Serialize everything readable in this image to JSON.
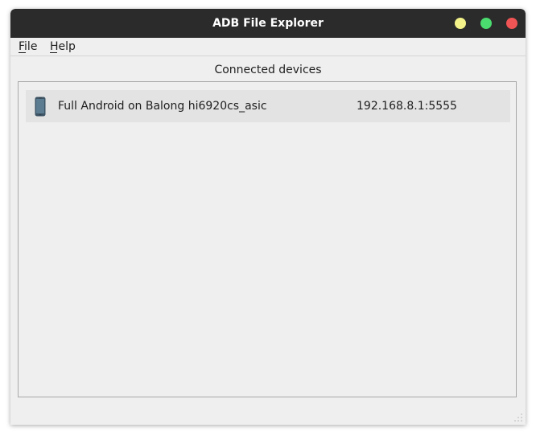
{
  "window": {
    "title": "ADB File Explorer",
    "controls": {
      "minimize_color": "#f3f38a",
      "maximize_color": "#4bdc6f",
      "close_color": "#f05454"
    }
  },
  "menubar": {
    "items": [
      {
        "label": "File",
        "icon": null
      },
      {
        "label": "Help",
        "icon": null
      }
    ]
  },
  "devices": {
    "heading": "Connected devices",
    "items": [
      {
        "name": "Full Android on Balong hi6920cs_asic",
        "address": "192.168.8.1:5555",
        "icon": "smartphone-icon"
      }
    ]
  }
}
